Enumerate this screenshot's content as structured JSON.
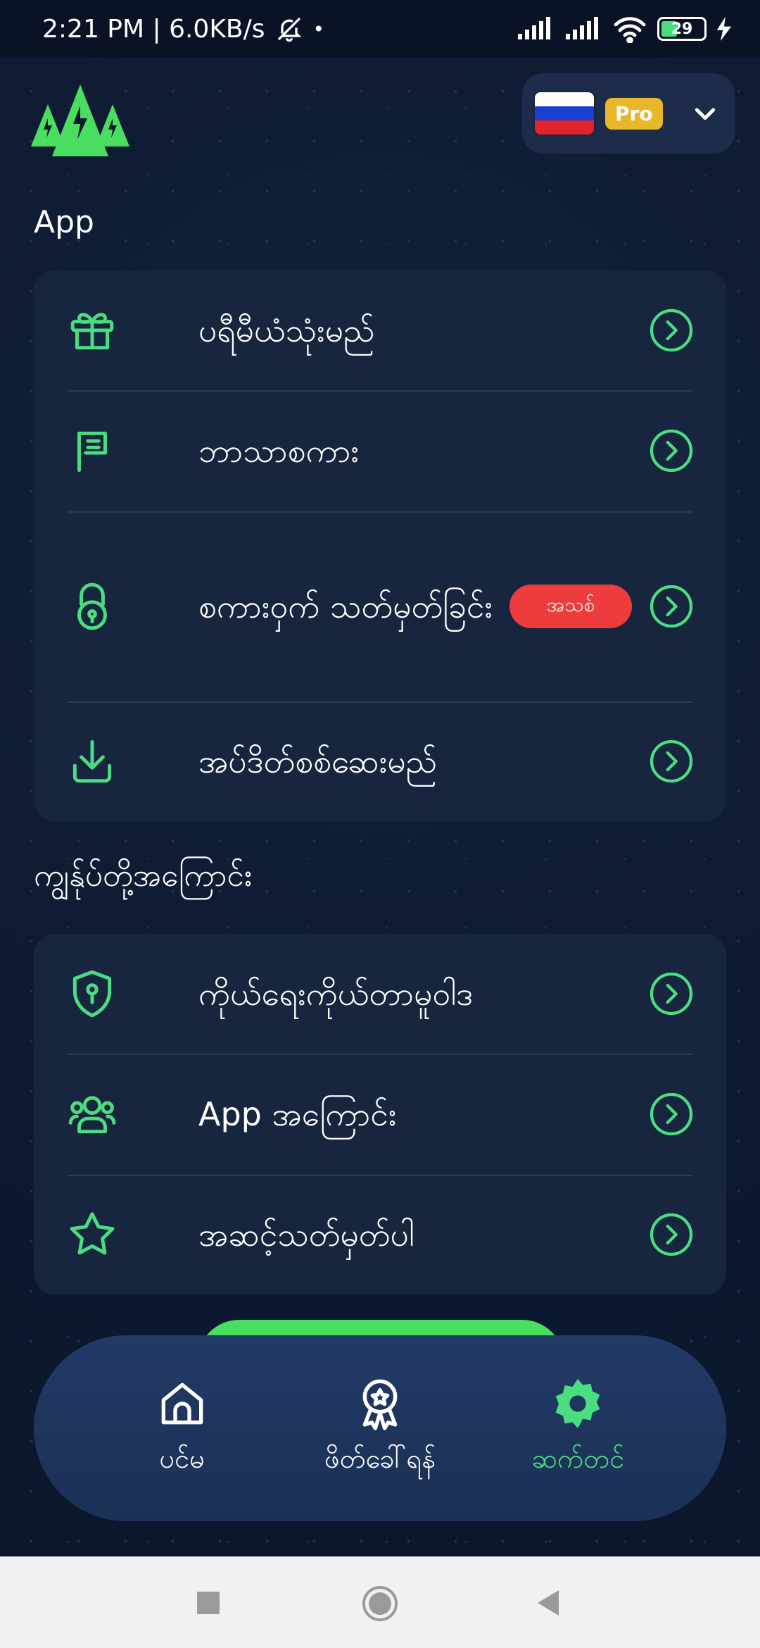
{
  "status_bar": {
    "time_speed": "2:21 PM | 6.0KB/s",
    "battery_level": "29"
  },
  "header": {
    "country_flag": "russia-flag",
    "pro_label": "Pro"
  },
  "app_section": {
    "title": "App",
    "items": [
      {
        "icon": "gift-icon",
        "label": "ပရီမီယံသုံးမည်"
      },
      {
        "icon": "language-icon",
        "label": "ဘာသာစကား"
      },
      {
        "icon": "lock-icon",
        "label": "စကားဝှက် သတ်မှတ်ခြင်း",
        "badge": "အသစ်"
      },
      {
        "icon": "download-icon",
        "label": "အပ်ဒိတ်စစ်ဆေးမည်"
      }
    ]
  },
  "about_section": {
    "title": "ကျွန်ုပ်တို့အကြောင်း",
    "items": [
      {
        "icon": "shield-icon",
        "label": "ကိုယ်ရေးကိုယ်တာမူဝါဒ"
      },
      {
        "icon": "users-icon",
        "label": "App အကြောင်း"
      },
      {
        "icon": "star-icon",
        "label": "အဆင့်သတ်မှတ်ပါ"
      }
    ]
  },
  "bottom_nav": {
    "items": [
      {
        "icon": "home-icon",
        "label": "ပင်မ",
        "active": false
      },
      {
        "icon": "award-icon",
        "label": "ဖိတ်ခေါ်ရန်",
        "active": false
      },
      {
        "icon": "settings-icon",
        "label": "ဆက်တင်",
        "active": true
      }
    ]
  },
  "colors": {
    "accent": "#4ade80",
    "background": "#0d1930",
    "card": "#17253f",
    "badge_red": "#ee3b3b",
    "pro_gold": "#e8b82a"
  }
}
